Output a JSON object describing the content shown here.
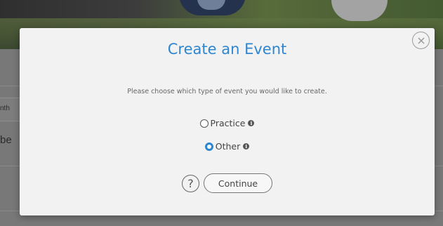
{
  "background": {
    "month_fragment": "nth",
    "row_fragment": "be"
  },
  "modal": {
    "title": "Create an Event",
    "subtitle": "Please choose which type of event you would like to create.",
    "options": [
      {
        "label": "Practice",
        "selected": false,
        "icon": "info-icon"
      },
      {
        "label": "Other",
        "selected": true,
        "icon": "info-icon"
      }
    ],
    "continue_label": "Continue",
    "help_icon": "question-circle-icon",
    "close_icon": "close-circle-icon",
    "accent_color": "#2f86cf"
  }
}
